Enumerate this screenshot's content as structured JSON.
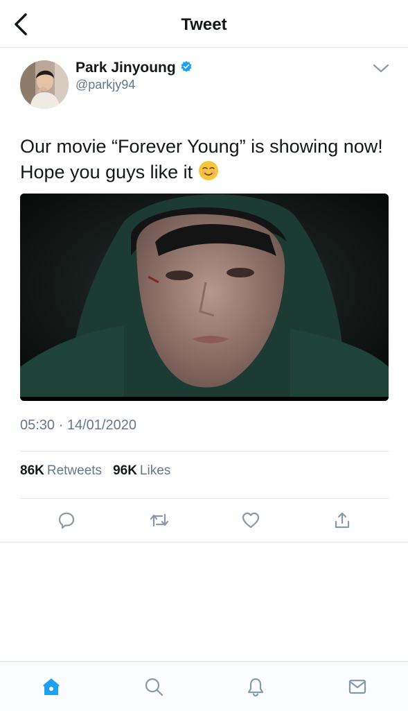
{
  "header": {
    "title": "Tweet"
  },
  "author": {
    "name": "Park Jinyoung",
    "handle": "@parkjy94",
    "verified": true
  },
  "tweet": {
    "text": "Our movie “Forever Young” is showing now! Hope you guys like it",
    "emoji": "smiling-face-icon",
    "media_description": "video-still-image"
  },
  "meta": {
    "time": "05:30",
    "separator": "·",
    "date": "14/01/2020"
  },
  "stats": {
    "retweets_count": "86K",
    "retweets_label": "Retweets",
    "likes_count": "96K",
    "likes_label": "Likes"
  },
  "actions": [
    "reply-icon",
    "retweet-icon",
    "like-icon",
    "share-icon"
  ],
  "tabbar": [
    "home-icon",
    "search-icon",
    "notifications-icon",
    "messages-icon"
  ],
  "colors": {
    "accent": "#1da1f2",
    "text": "#14171a",
    "secondary": "#657786",
    "divider": "#e1e8ed"
  }
}
